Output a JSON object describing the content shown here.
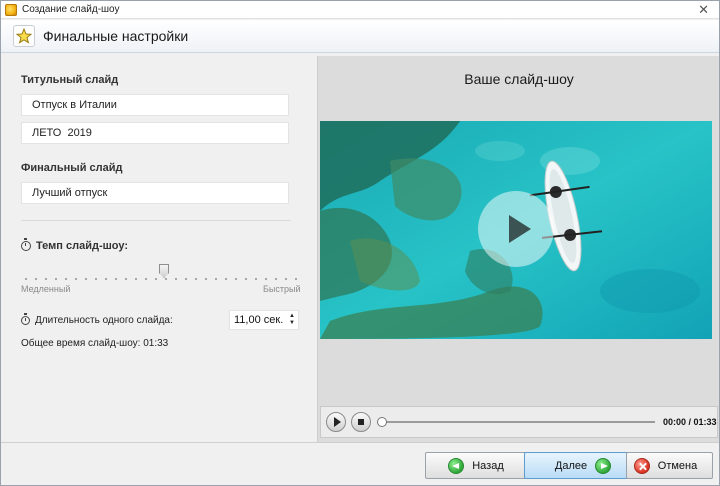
{
  "window": {
    "title": "Создание слайд-шоу",
    "close_glyph": "✕"
  },
  "header": {
    "title": "Финальные настройки",
    "icon": "star-icon"
  },
  "title_slide": {
    "label": "Титульный слайд",
    "line1": "Отпуск в Италии",
    "line2": "ЛЕТО  2019"
  },
  "final_slide": {
    "label": "Финальный слайд",
    "line1": "Лучший отпуск"
  },
  "tempo": {
    "label": "Темп слайд-шоу:",
    "slow": "Медленный",
    "fast": "Быстрый",
    "level": 0.5
  },
  "duration": {
    "label": "Длительность одного слайда:",
    "value": "11,00 сек."
  },
  "total": {
    "text": "Общее время слайд-шоу: 01:33"
  },
  "preview": {
    "title": "Ваше слайд-шоу",
    "timecode": "00:00 / 01:33"
  },
  "buttons": {
    "back": "Назад",
    "next": "Далее",
    "cancel": "Отмена"
  },
  "colors": {
    "water": "#1fb5bd",
    "next_accent": "#5d9bd1"
  }
}
